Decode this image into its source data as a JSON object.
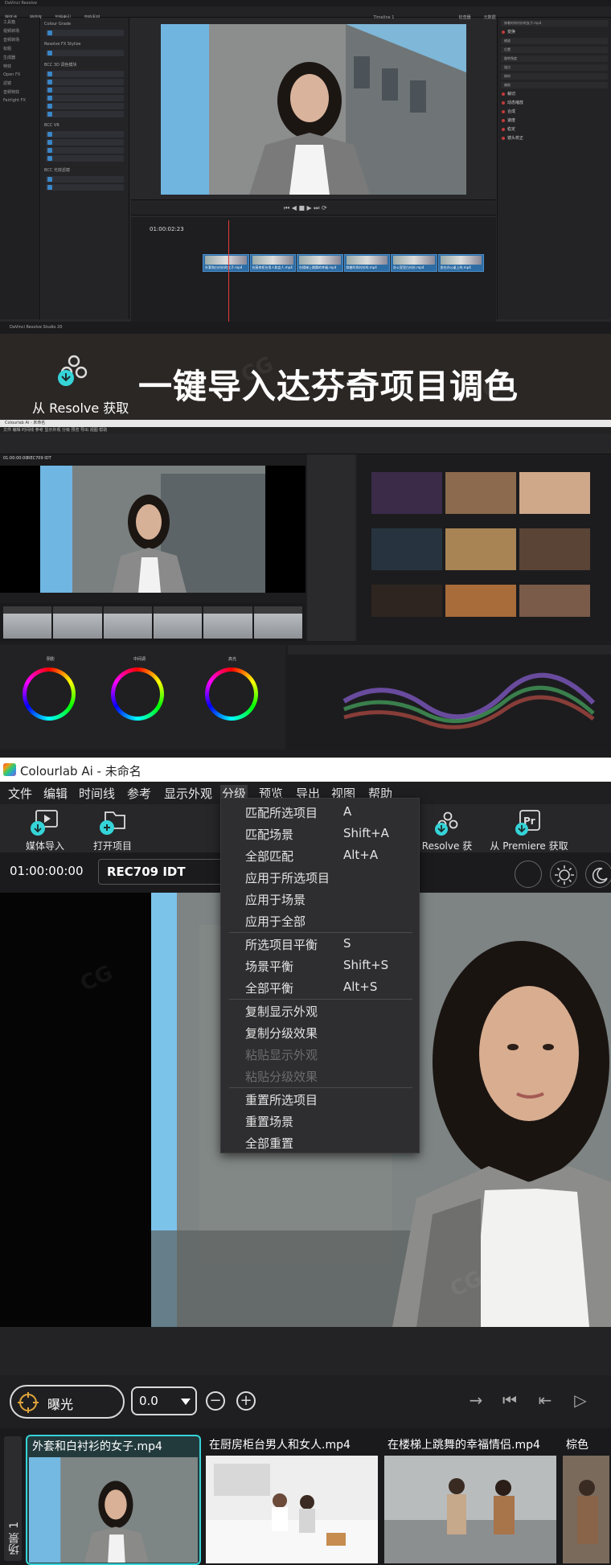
{
  "resolve": {
    "window_title": "DaVinci Resolve",
    "app_label": "DaVinci Resolve Studio 20",
    "toolbar_items": [
      "媒体池",
      "特效库",
      "剪辑索引",
      "音响素材",
      "检查器",
      "元数据"
    ],
    "timecode": "01:00:02:23",
    "timeline_name": "Timeline 1",
    "viewer_tc": "01:00:02:23",
    "inspector_file": "穿着时尚衬衫的女子.mp4",
    "left_panel": [
      "工具箱",
      "视频转场",
      "音频转场",
      "标题",
      "生成器",
      "特效",
      "Open FX",
      "滤镜",
      "音频特效",
      "Fairlight FX"
    ],
    "fx_groups": [
      "Colour Grade",
      "Resolve FX Stylize",
      "BCC 3D 调色模块",
      "BCC VR",
      "BCC 光效滤镜"
    ],
    "clip_labels": [
      "外套和白衬衫的女子.mp4",
      "在厨房柜台男人和女人.mp4",
      "在楼梯上跳舞的幸福.mp4",
      "穿着时尚衬衫的.mp4",
      "办公室里白衬衫.mp4",
      "坐在办公桌上的.mp4"
    ],
    "inspector_rows": [
      "缩放",
      "位置",
      "旋转角度",
      "锚点",
      "俯仰",
      "偏航"
    ],
    "inspector_heads": [
      "变换",
      "裁切",
      "动态缩放",
      "合成",
      "速度",
      "稳定",
      "镜头校正"
    ]
  },
  "banner": {
    "logo_label": "从 Resolve 获取",
    "headline": "一键导入达芬奇项目调色"
  },
  "colourlab_small": {
    "title": "Colourlab Ai - 未命名",
    "menu": "文件  编辑  时间线  参考  显示外观  分级  预览  导出  视图  帮助",
    "timecode": "01:00:00:00",
    "idt": "REC709 IDT",
    "wheels": [
      "阴影",
      "中间调",
      "高光"
    ]
  },
  "colourlab": {
    "app_title": "Colourlab Ai",
    "doc_title": " - 未命名",
    "menu": [
      "文件",
      "编辑",
      "时间线",
      "参考",
      "显示外观",
      "分级",
      "预览",
      "导出",
      "视图",
      "帮助"
    ],
    "active_menu": "分级",
    "toolbar": {
      "media_import": "媒体导入",
      "open_project": "打开项目",
      "resolve_fetch": "Resolve 获取",
      "premiere_fetch": "从 Premiere 获取"
    },
    "timecode": "01:00:00:00",
    "idt": "REC709 IDT",
    "control": {
      "mode": "曝光",
      "value": "0.0"
    },
    "scene_label": "场景 1",
    "clips": [
      {
        "name": "外套和白衬衫的女子.mp4",
        "selected": true
      },
      {
        "name": "在厨房柜台男人和女人.mp4",
        "selected": false
      },
      {
        "name": "在楼梯上跳舞的幸福情侣.mp4",
        "selected": false
      },
      {
        "name": "棕色",
        "selected": false
      }
    ],
    "accent_color": "#35d4d8"
  },
  "grade_menu": {
    "items": [
      {
        "label": "匹配所选项目",
        "shortcut": "A",
        "enabled": true
      },
      {
        "label": "匹配场景",
        "shortcut": "Shift+A",
        "enabled": true
      },
      {
        "label": "全部匹配",
        "shortcut": "Alt+A",
        "enabled": true
      },
      {
        "label": "应用于所选项目",
        "shortcut": "",
        "enabled": true
      },
      {
        "label": "应用于场景",
        "shortcut": "",
        "enabled": true
      },
      {
        "label": "应用于全部",
        "shortcut": "",
        "enabled": true
      },
      {
        "label": "所选项目平衡",
        "shortcut": "S",
        "enabled": true
      },
      {
        "label": "场景平衡",
        "shortcut": "Shift+S",
        "enabled": true
      },
      {
        "label": "全部平衡",
        "shortcut": "Alt+S",
        "enabled": true
      },
      {
        "label": "复制显示外观",
        "shortcut": "",
        "enabled": true
      },
      {
        "label": "复制分级效果",
        "shortcut": "",
        "enabled": true
      },
      {
        "label": "粘贴显示外观",
        "shortcut": "",
        "enabled": false
      },
      {
        "label": "粘贴分级效果",
        "shortcut": "",
        "enabled": false
      },
      {
        "label": "重置所选项目",
        "shortcut": "",
        "enabled": true
      },
      {
        "label": "重置场景",
        "shortcut": "",
        "enabled": true
      },
      {
        "label": "全部重置",
        "shortcut": "",
        "enabled": true
      }
    ]
  }
}
